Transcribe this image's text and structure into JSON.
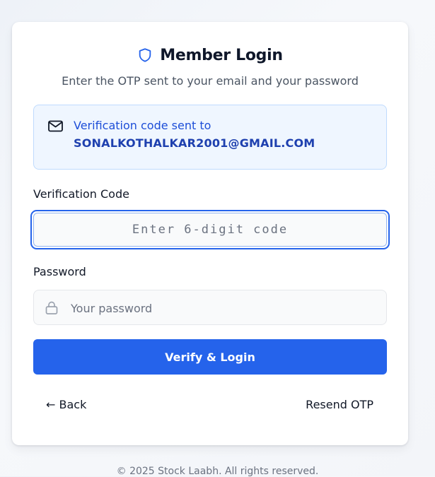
{
  "header": {
    "title": "Member Login",
    "subtitle": "Enter the OTP sent to your email and your password",
    "title_icon": "shield-icon"
  },
  "info": {
    "icon": "mail-icon",
    "line1": "Verification code sent to",
    "email": "SONALKOTHALKAR2001@GMAIL.COM"
  },
  "form": {
    "code_label": "Verification Code",
    "code_placeholder": "Enter 6-digit code",
    "code_value": "",
    "password_label": "Password",
    "password_placeholder": "Your password",
    "password_value": "",
    "password_icon": "lock-icon",
    "submit_label": "Verify & Login"
  },
  "actions": {
    "back_label": "← Back",
    "resend_label": "Resend OTP"
  },
  "footer": {
    "text": "© 2025 Stock Laabh. All rights reserved."
  },
  "colors": {
    "accent": "#2563eb",
    "info_bg": "#eff6ff",
    "info_text": "#1d4ed8"
  }
}
